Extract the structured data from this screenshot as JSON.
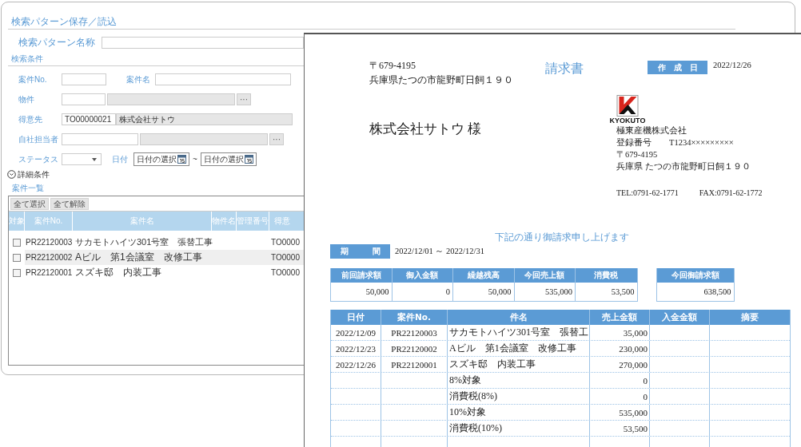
{
  "search_window": {
    "pattern_section": "検索パターン保存／読込",
    "pattern_name_label": "検索パターン名称",
    "conditions_section": "検索条件",
    "case_no_label": "案件No.",
    "case_name_label": "案件名",
    "property_label": "物件",
    "browse_button": "···",
    "customer_label": "得意先",
    "customer_code": "TO00000021",
    "customer_name": "株式会社サトウ",
    "staff_label": "自社担当者",
    "status_label": "ステータス",
    "date_label": "日付",
    "date_from_placeholder": "日付の選択",
    "range_separator": "~",
    "date_to_placeholder": "日付の選択",
    "detail_toggle": "詳細条件",
    "list_title": "案件一覧",
    "buttons": [
      "全て選択",
      "全て解除"
    ],
    "columns": [
      "対象",
      "案件No.",
      "案件名",
      "物件名",
      "管理番号",
      "得意"
    ],
    "rows": [
      {
        "checked": false,
        "selected": false,
        "case_no": "PR22120003",
        "name": "サカモトハイツ301号室　張替工事",
        "customer": "TO0000"
      },
      {
        "checked": false,
        "selected": true,
        "case_no": "PR22120002",
        "name": "Aビル　第1会議室　改修工事",
        "customer": "TO0000"
      },
      {
        "checked": false,
        "selected": false,
        "case_no": "PR22120001",
        "name": "スズキ邸　内装工事",
        "customer": "TO0000"
      }
    ]
  },
  "invoice": {
    "postal": "〒679-4195",
    "address": "兵庫県たつの市龍野町日飼１９０",
    "title": "請求書",
    "created_label": "作　成　日",
    "created_date": "2022/12/26",
    "recipient": "株式会社サトウ 様",
    "logo_text": "KYOKUTO",
    "issuer_lines": [
      "極東産機株式会社",
      "登録番号　　T1234×××××××××",
      "〒679-4195",
      "兵庫県 たつの市龍野町日飼１９０"
    ],
    "tel": "TEL:0791-62-1771",
    "fax": "FAX:0791-62-1772",
    "message": "下記の通り御請求申し上げます",
    "period_label": "期　　　間",
    "period": "2022/12/01 ～ 2022/12/31",
    "summary": {
      "columns": [
        "前回請求額",
        "御入金額",
        "繰越残高",
        "今回売上額",
        "消費税"
      ],
      "values": [
        "50,000",
        "0",
        "50,000",
        "535,000",
        "53,500"
      ]
    },
    "total": {
      "label": "今回御請求額",
      "value": "638,500"
    },
    "detail": {
      "columns": [
        "日付",
        "案件No.",
        "件名",
        "売上金額",
        "入金金額",
        "摘要"
      ],
      "rows": [
        {
          "date": "2022/12/09",
          "case_no": "PR22120003",
          "name": "サカモトハイツ301号室　張替工",
          "amount": "35,000"
        },
        {
          "date": "2022/12/23",
          "case_no": "PR22120002",
          "name": "Aビル　第1会議室　改修工事",
          "amount": "230,000"
        },
        {
          "date": "2022/12/26",
          "case_no": "PR22120001",
          "name": "スズキ邸　内装工事",
          "amount": "270,000"
        },
        {
          "name": "8%対象",
          "amount": "0"
        },
        {
          "name": "消費税(8%)",
          "amount": "0"
        },
        {
          "name": "10%対象",
          "amount": "535,000"
        },
        {
          "name": "消費税(10%)",
          "amount": "53,500"
        }
      ]
    }
  }
}
